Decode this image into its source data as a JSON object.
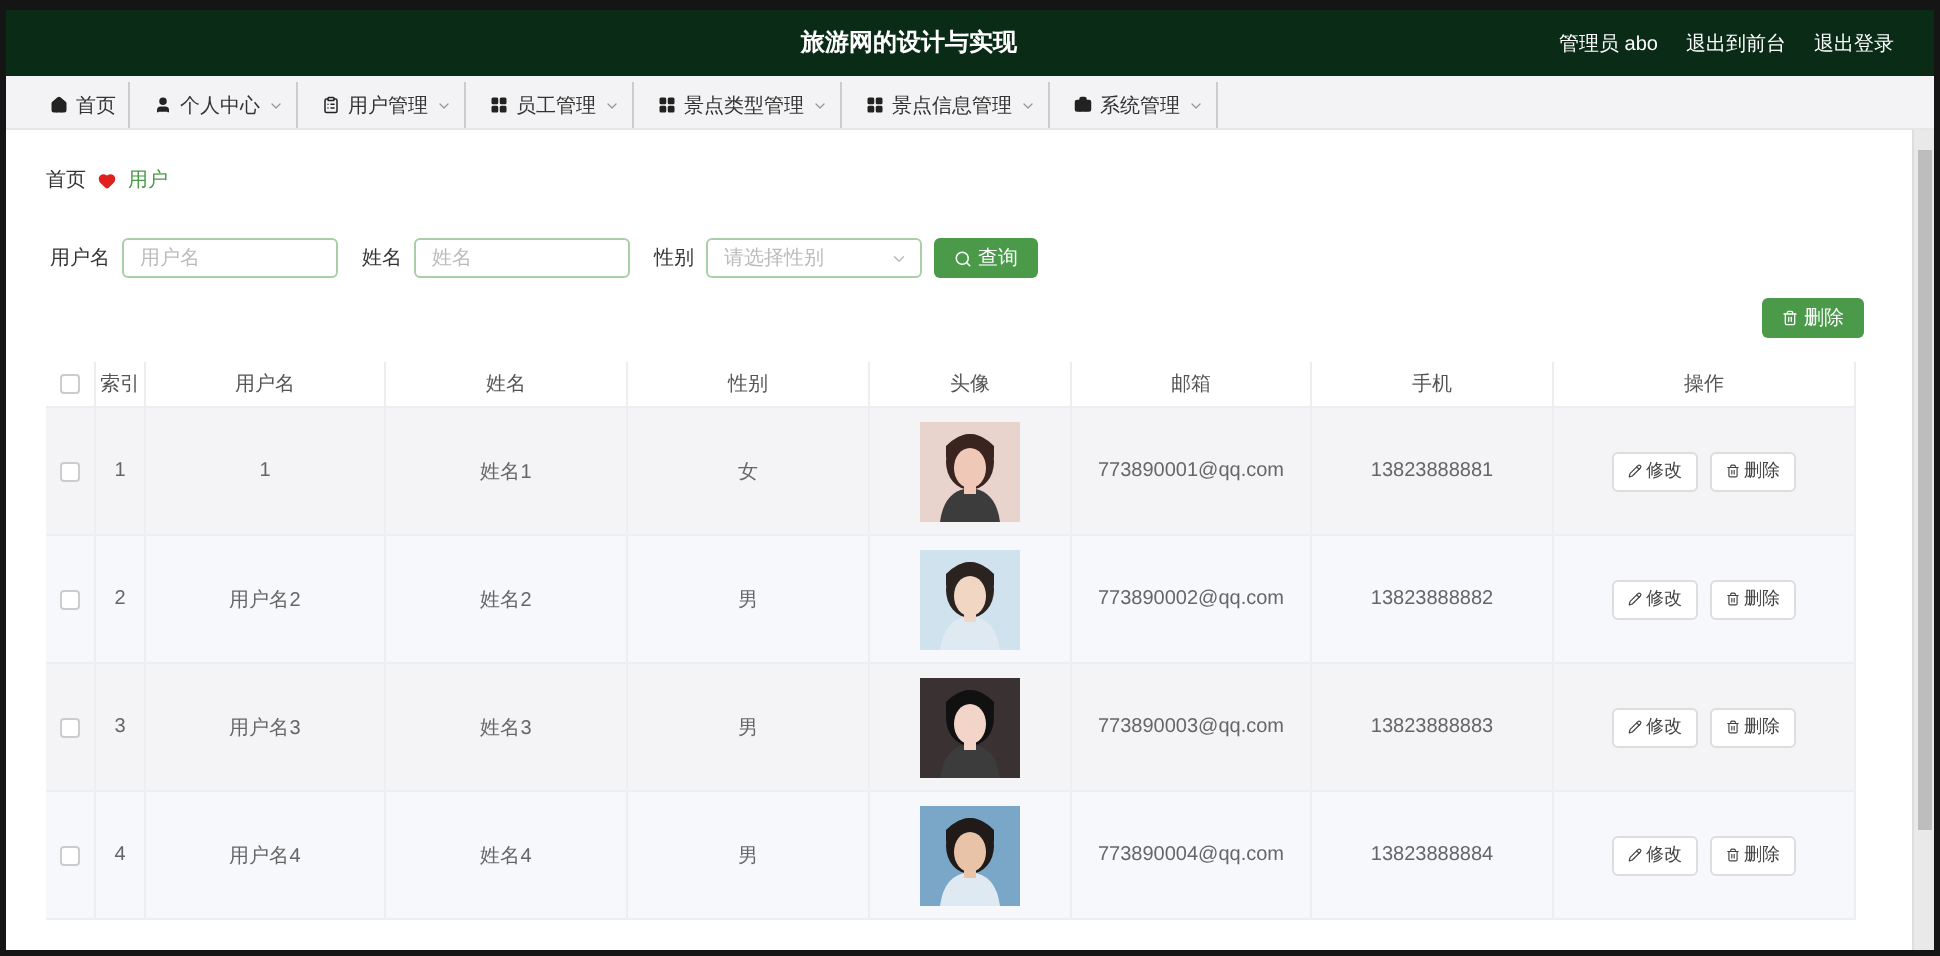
{
  "header": {
    "title": "旅游网的设计与实现",
    "user": "管理员 abo",
    "links": [
      "退出到前台",
      "退出登录"
    ]
  },
  "nav": [
    {
      "label": "首页",
      "has_menu": false
    },
    {
      "label": "个人中心",
      "has_menu": true
    },
    {
      "label": "用户管理",
      "has_menu": true
    },
    {
      "label": "员工管理",
      "has_menu": true
    },
    {
      "label": "景点类型管理",
      "has_menu": true
    },
    {
      "label": "景点信息管理",
      "has_menu": true
    },
    {
      "label": "系统管理",
      "has_menu": true
    }
  ],
  "breadcrumb": {
    "home": "首页",
    "current": "用户"
  },
  "search": {
    "fields": [
      {
        "label": "用户名",
        "placeholder": "用户名",
        "kind": "input"
      },
      {
        "label": "姓名",
        "placeholder": "姓名",
        "kind": "input"
      },
      {
        "label": "性别",
        "placeholder": "请选择性别",
        "kind": "select"
      }
    ],
    "button": "查询"
  },
  "delete_button": "删除",
  "table": {
    "select_all": {
      "checked": false
    },
    "columns": [
      "索引",
      "用户名",
      "姓名",
      "性别",
      "头像",
      "邮箱",
      "手机",
      "操作"
    ],
    "rows": [
      {
        "checked": false,
        "index": "1",
        "username": "1",
        "name": "姓名1",
        "gender": "女",
        "avatar": {
          "kind": "picture"
        },
        "email": "773890001@qq.com",
        "phone": "13823888881",
        "actions": [
          "修改",
          "删除"
        ]
      },
      {
        "checked": false,
        "index": "2",
        "username": "用户名2",
        "name": "姓名2",
        "gender": "男",
        "avatar": {
          "kind": "picture"
        },
        "email": "773890002@qq.com",
        "phone": "13823888882",
        "actions": [
          "修改",
          "删除"
        ]
      },
      {
        "checked": false,
        "index": "3",
        "username": "用户名3",
        "name": "姓名3",
        "gender": "男",
        "avatar": {
          "kind": "picture"
        },
        "email": "773890003@qq.com",
        "phone": "13823888883",
        "actions": [
          "修改",
          "删除"
        ]
      },
      {
        "checked": false,
        "index": "4",
        "username": "用户名4",
        "name": "姓名4",
        "gender": "男",
        "avatar": {
          "kind": "picture"
        },
        "email": "773890004@qq.com",
        "phone": "13823888884",
        "actions": [
          "修改",
          "删除"
        ]
      }
    ]
  }
}
